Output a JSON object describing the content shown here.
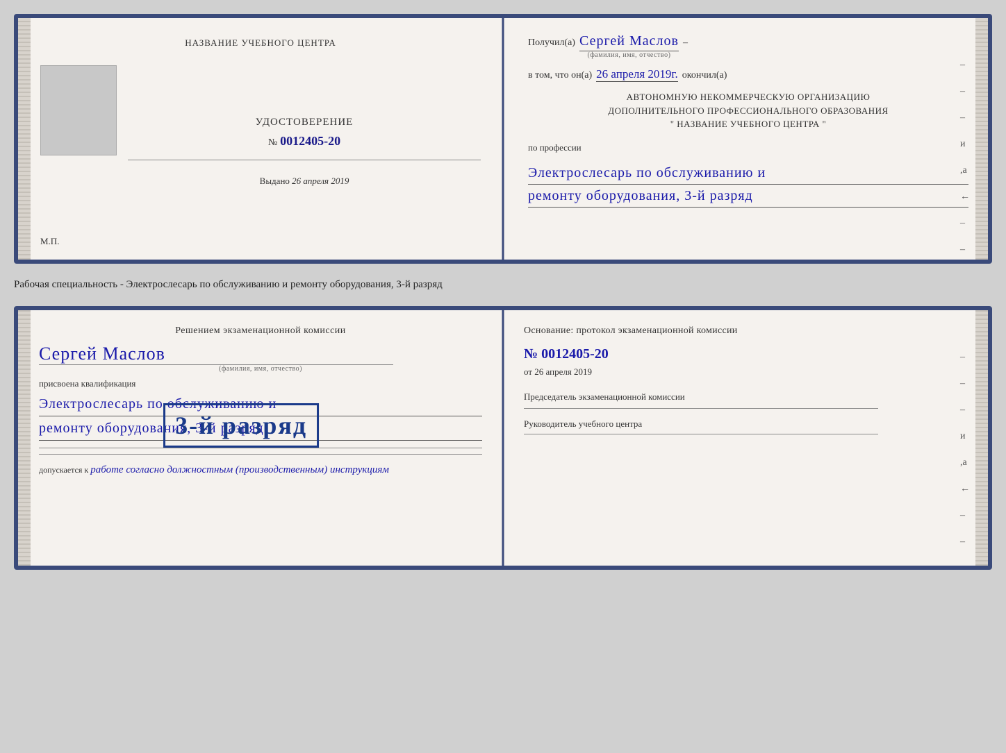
{
  "top_cert": {
    "left": {
      "school_name": "НАЗВАНИЕ УЧЕБНОГО ЦЕНТРА",
      "cert_label": "УДОСТОВЕРЕНИЕ",
      "cert_number_prefix": "№",
      "cert_number": "0012405-20",
      "vydano_label": "Выдано",
      "vydano_date": "26 апреля 2019",
      "mp_label": "М.П."
    },
    "right": {
      "poluchil_label": "Получил(а)",
      "recipient_name": "Сергей Маслов",
      "fio_caption": "(фамилия, имя, отчество)",
      "dash": "–",
      "vtom_label": "в том, что он(а)",
      "completed_date": "26 апреля 2019г.",
      "okochil_label": "окончил(а)",
      "org_line1": "АВТОНОМНУЮ НЕКОММЕРЧЕСКУЮ ОРГАНИЗАЦИЮ",
      "org_line2": "ДОПОЛНИТЕЛЬНОГО ПРОФЕССИОНАЛЬНОГО ОБРАЗОВАНИЯ",
      "org_line3": "\"    НАЗВАНИЕ УЧЕБНОГО ЦЕНТРА    \"",
      "po_professii": "по профессии",
      "profession_line1": "Электрослесарь по обслуживанию и",
      "profession_line2": "ремонту оборудования, 3-й разряд"
    }
  },
  "specialty_label": "Рабочая специальность - Электрослесарь по обслуживанию и ремонту оборудования, 3-й разряд",
  "bottom_cert": {
    "left": {
      "resheniem_title": "Решением экзаменационной комиссии",
      "recipient_name": "Сергей Маслов",
      "fio_caption": "(фамилия, имя, отчество)",
      "prisvoena_label": "присвоена квалификация",
      "qual_line1": "Электрослесарь по обслуживанию и",
      "qual_line2": "ремонту оборудования, 3-й разряд",
      "dopuskaetsya_label": "допускается к",
      "dopuskaetsya_value": "работе согласно должностным (производственным) инструкциям"
    },
    "stamp": {
      "text": "3-й разряд"
    },
    "right": {
      "osnovanie_title": "Основание: протокол экзаменационной комиссии",
      "cert_num_prefix": "№",
      "cert_num": "0012405-20",
      "ot_label": "от",
      "ot_date": "26 апреля 2019",
      "predsedatel_label": "Председатель экзаменационной комиссии",
      "rukovoditel_label": "Руководитель учебного центра"
    }
  }
}
